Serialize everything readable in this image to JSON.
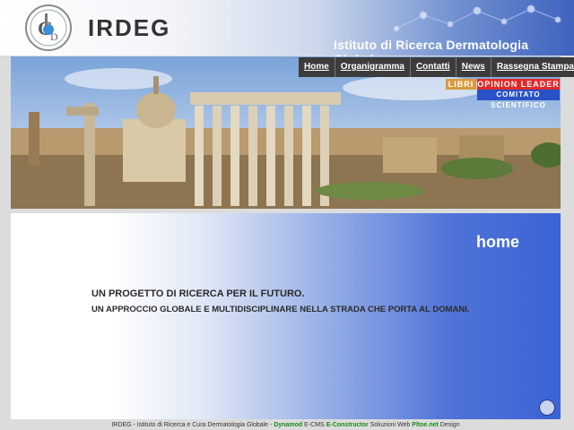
{
  "header": {
    "brand": "IRDEG",
    "subtitle": "Istituto di Ricerca Dermatologia Globale"
  },
  "nav": {
    "items": [
      "Home",
      "Organigramma",
      "Contatti",
      "News",
      "Rassegna Stampa"
    ]
  },
  "tags": {
    "libri": "LIBRI",
    "opinion_leader": "OPINION LEADER",
    "comitato": "COMITATO SCIENTIFICO"
  },
  "main": {
    "heading": "home",
    "line1": "UN PROGETTO DI RICERCA PER IL FUTURO.",
    "line2": "UN APPROCCIO GLOBALE E MULTIDISCIPLINARE NELLA STRADA CHE PORTA AL DOMANI."
  },
  "footer": {
    "text1": "IRDEG - Istituto di Ricerca e Cura Dermatologia Globale -",
    "link1": "Dynamod",
    "text2": "E-CMS",
    "link2": "E-Constructor",
    "text3": "Soluzioni Web",
    "link3": "Pltoe.net",
    "text4": "Design"
  },
  "colors": {
    "nav_bg": "#3c3c3c",
    "libri": "#d79a3c",
    "opinion_leader": "#e02a2a",
    "comitato": "#2a52c8",
    "content_blue": "#3b63d4"
  }
}
